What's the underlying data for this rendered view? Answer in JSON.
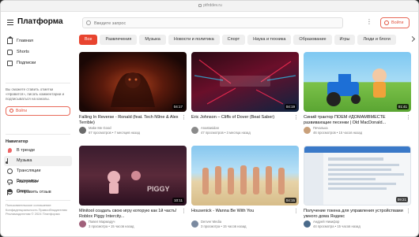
{
  "browser": {
    "url": "ptfrddev.ru"
  },
  "header": {
    "logo": "Платформа",
    "search_placeholder": "Введите запрос",
    "more_label": "⋮",
    "login_label": "Войти"
  },
  "sidebar": {
    "nav": [
      {
        "label": "Главная",
        "icon": "home-icon"
      },
      {
        "label": "Shorts",
        "icon": "shorts-icon"
      },
      {
        "label": "Подписки",
        "icon": "subscriptions-icon"
      }
    ],
    "note": "Вы сможете ставить отметки «Нравится», писать комментарии и подписываться на каналы.",
    "login_label": "Войти",
    "nav_heading": "Навигатор",
    "navigator": [
      {
        "label": "В тренде",
        "icon": "fire-icon"
      },
      {
        "label": "Музыка",
        "icon": "music-icon"
      },
      {
        "label": "Трансляции",
        "icon": "live-icon"
      },
      {
        "label": "Видеоигры",
        "icon": "gamepad-icon"
      },
      {
        "label": "Спорт",
        "icon": "sport-icon"
      }
    ],
    "bottom": [
      {
        "label": "Настройки",
        "icon": "gear-icon"
      },
      {
        "label": "Отправить отзыв",
        "icon": "flag-icon"
      }
    ],
    "footer": "Пользовательское соглашение Конфиденциальность Правообладателям Рекламодателям © 2024 Платформа"
  },
  "chips": [
    "Все",
    "Развлечения",
    "Музыка",
    "Новости и политика",
    "Спорт",
    "Наука и техника",
    "Образование",
    "Игры",
    "Люди и блоги"
  ],
  "videos": [
    {
      "title": "Falling In Reverse - Ronald (feat. Tech N9ne & Alex Terrible)",
      "channel": "Make Me Good",
      "stats": "67 просмотров • 7 месяцев назад",
      "duration": "04:17"
    },
    {
      "title": "Eric Johnson – Cliffs of Dover (Beat Saber)",
      "channel": "Anastasidan",
      "stats": "47 просмотров • 3 месяца назад",
      "duration": "04:19"
    },
    {
      "title": "Синий трактор ПОЁМ #ДОМАМВМЕСТЕ развивающие песенки | Old MacDonald...",
      "channel": "Печалька",
      "stats": "46 просмотров • 15 часов назад",
      "duration": "01:41"
    },
    {
      "title": "Minitool создать свою игру которую как 1й часть! Roblox Piggy Intercity...",
      "channel": "Павел Мармадуч",
      "stats": "3 просмотра • 15 часов назад",
      "duration": "10:11"
    },
    {
      "title": "Housenick - Wanna Be With You",
      "channel": "Denver Media",
      "stats": "3 просмотра • 15 часов назад",
      "duration": "04:15"
    },
    {
      "title": "Получение токена для управления устройствами умного дома Яндекс",
      "channel": "Андрей Никифор",
      "stats": "44 просмотра • 15 часов назад",
      "duration": "09:21"
    }
  ],
  "colors": {
    "accent": "#e8442f"
  }
}
